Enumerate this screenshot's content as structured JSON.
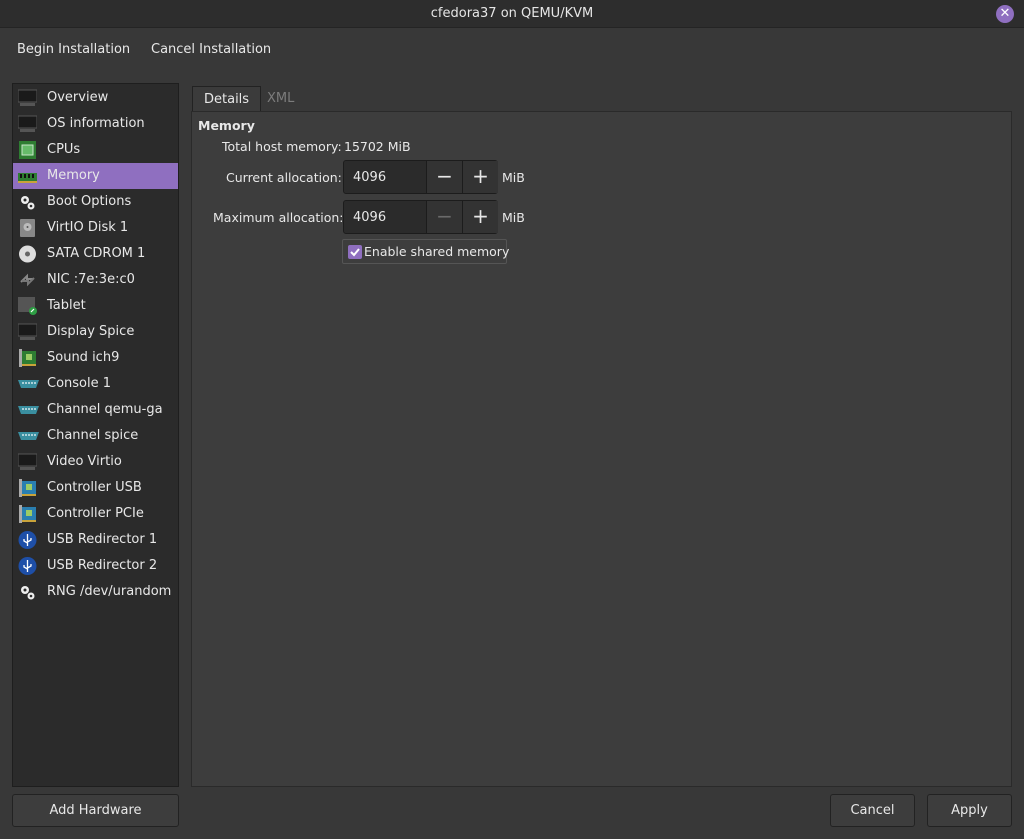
{
  "window": {
    "title": "cfedora37 on QEMU/KVM"
  },
  "menubar": {
    "begin": "Begin Installation",
    "cancel": "Cancel Installation"
  },
  "sidebar": {
    "items": [
      {
        "label": "Overview",
        "icon": "monitor-icon"
      },
      {
        "label": "OS information",
        "icon": "monitor-icon"
      },
      {
        "label": "CPUs",
        "icon": "cpu-icon"
      },
      {
        "label": "Memory",
        "icon": "memory-icon",
        "selected": true
      },
      {
        "label": "Boot Options",
        "icon": "gears-icon"
      },
      {
        "label": "VirtIO Disk 1",
        "icon": "disk-icon"
      },
      {
        "label": "SATA CDROM 1",
        "icon": "cdrom-icon"
      },
      {
        "label": "NIC :7e:3e:c0",
        "icon": "network-icon"
      },
      {
        "label": "Tablet",
        "icon": "tablet-icon"
      },
      {
        "label": "Display Spice",
        "icon": "monitor-icon"
      },
      {
        "label": "Sound ich9",
        "icon": "sound-card-icon"
      },
      {
        "label": "Console 1",
        "icon": "serial-port-icon"
      },
      {
        "label": "Channel qemu-ga",
        "icon": "serial-port-icon"
      },
      {
        "label": "Channel spice",
        "icon": "serial-port-icon"
      },
      {
        "label": "Video Virtio",
        "icon": "monitor-icon"
      },
      {
        "label": "Controller USB",
        "icon": "controller-card-icon"
      },
      {
        "label": "Controller PCIe",
        "icon": "controller-card-icon"
      },
      {
        "label": "USB Redirector 1",
        "icon": "usb-icon"
      },
      {
        "label": "USB Redirector 2",
        "icon": "usb-icon"
      },
      {
        "label": "RNG /dev/urandom",
        "icon": "gears-icon"
      }
    ]
  },
  "tabs": {
    "details": "Details",
    "xml": "XML"
  },
  "memory": {
    "section_title": "Memory",
    "total_label": "Total host memory:",
    "total_value": "15702 MiB",
    "current_label": "Current allocation:",
    "current_value": "4096",
    "max_label": "Maximum allocation:",
    "max_value": "4096",
    "unit": "MiB",
    "shared_label": "Enable shared memory",
    "shared_checked": true
  },
  "buttons": {
    "add_hardware": "Add Hardware",
    "cancel": "Cancel",
    "apply": "Apply"
  },
  "colors": {
    "accent": "#8f6fc0",
    "background": "#383838",
    "sidebar": "#2b2b2b"
  }
}
